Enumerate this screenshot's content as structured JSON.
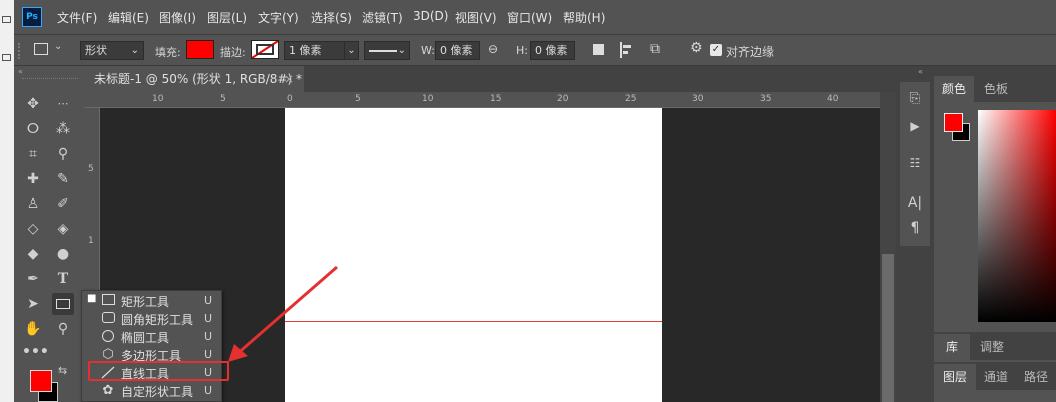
{
  "app": {
    "logo": "Ps"
  },
  "menu": [
    "文件(F)",
    "编辑(E)",
    "图像(I)",
    "图层(L)",
    "文字(Y)",
    "选择(S)",
    "滤镜(T)",
    "3D(D)",
    "视图(V)",
    "窗口(W)",
    "帮助(H)"
  ],
  "options": {
    "mode_value": "形状",
    "fill_label": "填充:",
    "fill_color": "#ff0000",
    "stroke_label": "描边:",
    "stroke_width": "1 像素",
    "w_label": "W:",
    "w_value": "0 像素",
    "h_label": "H:",
    "h_value": "0 像素",
    "align_edges_label": "对齐边缘",
    "align_edges_checked": true
  },
  "document": {
    "tab_title": "未标题-1 @ 50% (形状 1, RGB/8#) *",
    "close_glyph": "×",
    "ruler_h": [
      "10",
      "5",
      "0",
      "5",
      "10",
      "15",
      "20",
      "25",
      "30",
      "35",
      "40"
    ],
    "ruler_v": [
      "5",
      "1"
    ],
    "line_color": "#e33b3b"
  },
  "flyout": {
    "items": [
      {
        "label": "矩形工具",
        "shortcut": "U",
        "icon": "rectangle-icon",
        "active": true
      },
      {
        "label": "圆角矩形工具",
        "shortcut": "U",
        "icon": "rounded-rectangle-icon",
        "active": false
      },
      {
        "label": "椭圆工具",
        "shortcut": "U",
        "icon": "ellipse-icon",
        "active": false
      },
      {
        "label": "多边形工具",
        "shortcut": "U",
        "icon": "polygon-icon",
        "active": false
      },
      {
        "label": "直线工具",
        "shortcut": "U",
        "icon": "line-icon",
        "active": false
      },
      {
        "label": "自定形状工具",
        "shortcut": "U",
        "icon": "custom-shape-icon",
        "active": false
      }
    ],
    "highlight_color": "#e53030"
  },
  "colors": {
    "foreground": "#ff0000",
    "background": "#000000"
  },
  "panels": {
    "color_tabs": [
      "颜色",
      "色板"
    ],
    "lib_tabs": [
      "库",
      "调整"
    ],
    "layer_tabs": [
      "图层",
      "通道",
      "路径"
    ]
  }
}
